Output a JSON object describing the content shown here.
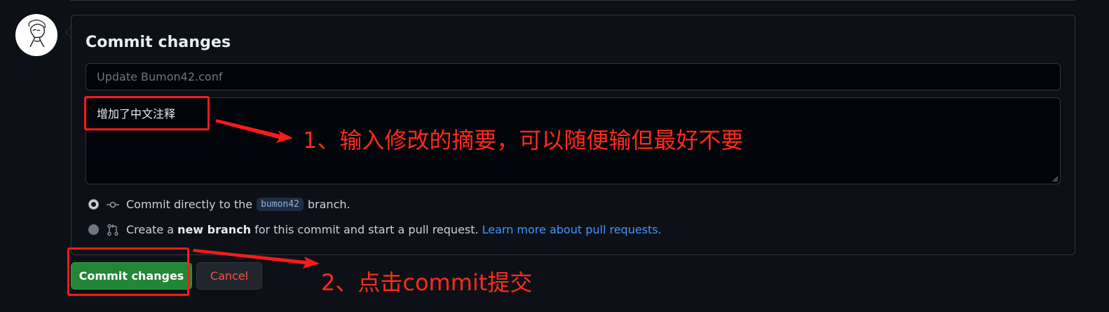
{
  "commit_panel": {
    "title": "Commit changes",
    "summary_placeholder": "Update Bumon42.conf",
    "summary_value": "",
    "description_value": "增加了中文注释"
  },
  "options": {
    "direct": {
      "prefix": "Commit directly to the",
      "branch": "bumon42",
      "suffix": "branch."
    },
    "new_branch": {
      "prefix": "Create a",
      "bold": "new branch",
      "middle": "for this commit and start a pull request.",
      "link": "Learn more about pull requests."
    }
  },
  "buttons": {
    "commit_label": "Commit changes",
    "cancel_label": "Cancel"
  },
  "annotations": {
    "step1": "1、输入修改的摘要，可以随便输但最好不要",
    "step2": "2、点击commit提交"
  },
  "colors": {
    "commit_button": "#238636",
    "cancel_text": "#f85149",
    "annotation": "#ff2a1a",
    "link": "#4493f8"
  },
  "icons": {
    "avatar": "sketch-portrait",
    "direct": "git-commit-icon",
    "new_branch": "git-pull-request-icon"
  }
}
